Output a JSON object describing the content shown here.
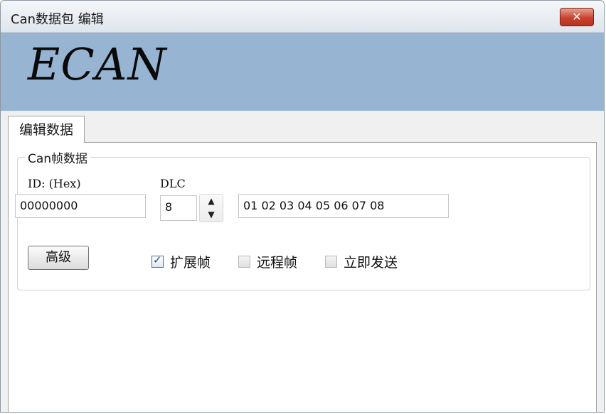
{
  "window": {
    "title": "Can数据包 编辑",
    "close_label": "✕",
    "logo": "ECAN"
  },
  "tabs": [
    {
      "label": "编辑数据",
      "selected": true
    }
  ],
  "group": {
    "legend": "Can帧数据",
    "id_label": "ID: (Hex)",
    "id_value": "00000000",
    "dlc_label": "DLC",
    "dlc_value": "8",
    "spin_up": "▲",
    "spin_down": "▼",
    "data_value": "01 02 03 04 05 06 07 08",
    "advanced_button": "高级",
    "checkboxes": [
      {
        "label": "扩展帧",
        "checked": true
      },
      {
        "label": "远程帧",
        "checked": false
      },
      {
        "label": "立即发送",
        "checked": false
      }
    ],
    "check_mark": "✓"
  }
}
